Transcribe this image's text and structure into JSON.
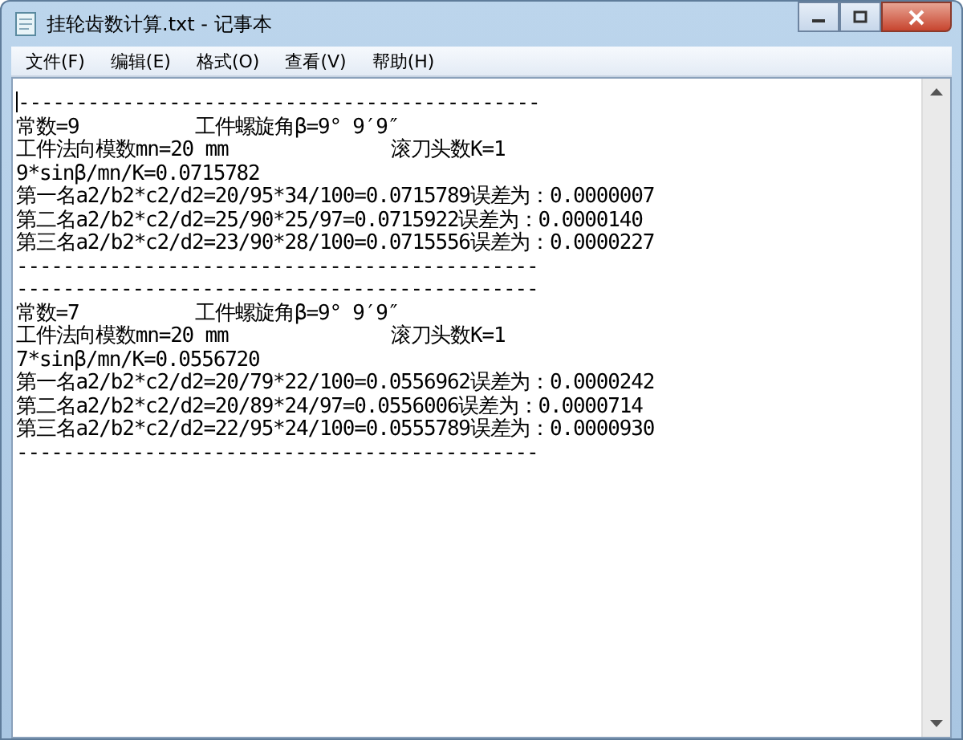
{
  "window": {
    "title": "挂轮齿数计算.txt - 记事本"
  },
  "menu": [
    "文件(F)",
    "编辑(E)",
    "格式(O)",
    "查看(V)",
    "帮助(H)"
  ],
  "editor": {
    "lines": [
      "---------------------------------------------",
      "常数=9          工件螺旋角β=9° 9′9″",
      "工件法向模数mn=20 mm              滚刀头数K=1",
      "9*sinβ/mn/K=0.0715782",
      "第一名a2/b2*c2/d2=20/95*34/100=0.0715789误差为：0.0000007",
      "第二名a2/b2*c2/d2=25/90*25/97=0.0715922误差为：0.0000140",
      "第三名a2/b2*c2/d2=23/90*28/100=0.0715556误差为：0.0000227",
      "---------------------------------------------",
      "---------------------------------------------",
      "常数=7          工件螺旋角β=9° 9′9″",
      "工件法向模数mn=20 mm              滚刀头数K=1",
      "7*sinβ/mn/K=0.0556720",
      "第一名a2/b2*c2/d2=20/79*22/100=0.0556962误差为：0.0000242",
      "第二名a2/b2*c2/d2=20/89*24/97=0.0556006误差为：0.0000714",
      "第三名a2/b2*c2/d2=22/95*24/100=0.0555789误差为：0.0000930",
      "---------------------------------------------"
    ]
  }
}
